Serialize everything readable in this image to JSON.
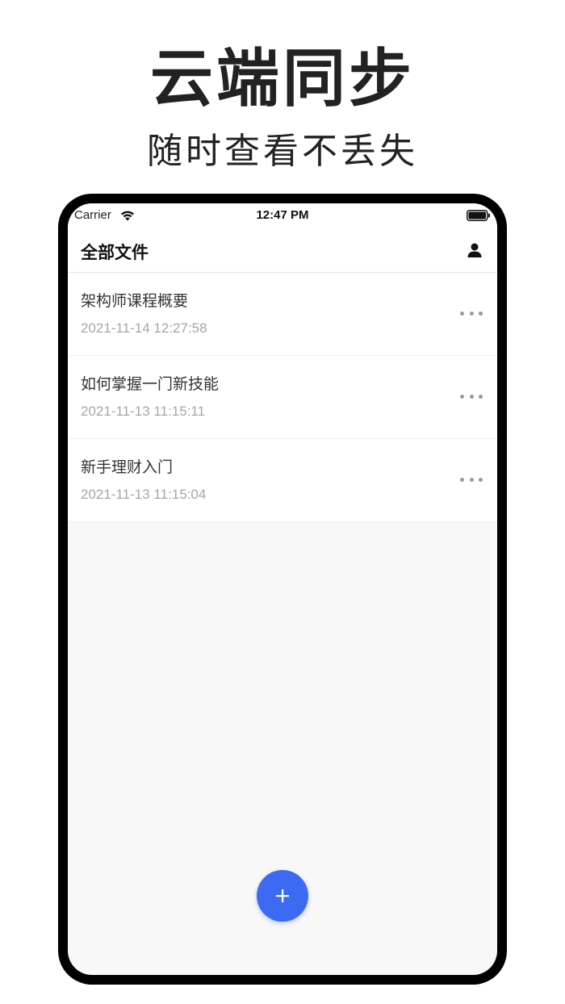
{
  "promo": {
    "title": "云端同步",
    "subtitle": "随时查看不丢失"
  },
  "status_bar": {
    "carrier": "Carrier",
    "time": "12:47 PM"
  },
  "nav": {
    "title": "全部文件",
    "profile_icon": "person-icon"
  },
  "files": [
    {
      "name": "架构师课程概要",
      "date": "2021-11-14 12:27:58"
    },
    {
      "name": "如何掌握一门新技能",
      "date": "2021-11-13 11:15:11"
    },
    {
      "name": "新手理财入门",
      "date": "2021-11-13 11:15:04"
    }
  ],
  "fab": {
    "icon": "plus-icon"
  },
  "colors": {
    "accent": "#3d6af2",
    "background": "#f8f8f8",
    "date_text": "#a6a6a6"
  }
}
